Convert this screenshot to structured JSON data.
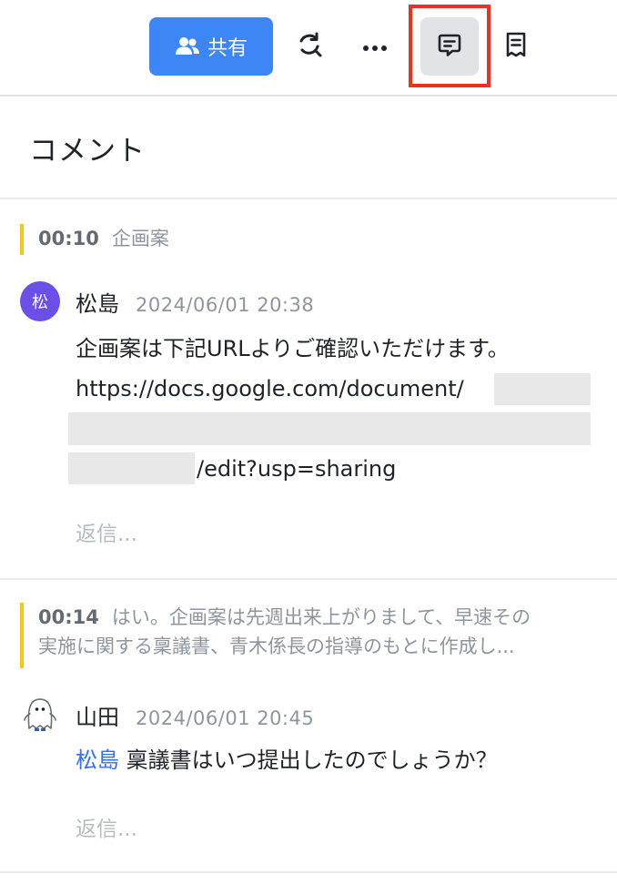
{
  "toolbar": {
    "share_label": "共有",
    "icons": {
      "share": "people-icon",
      "refresh": "refresh-search-icon",
      "more": "more-dots-icon",
      "comment": "comment-icon",
      "doc": "document-icon"
    },
    "accent_color": "#3c86f5",
    "highlight_color": "#e8341f"
  },
  "panel": {
    "title": "コメント"
  },
  "threads": [
    {
      "quote_time": "00:10",
      "quote_text": "企画案",
      "comment": {
        "avatar_text": "松",
        "author": "松島",
        "timestamp": "2024/06/01 20:38",
        "line1": "企画案は下記URLよりご確認いただけます。",
        "url_start": "https://docs.google.com/document/",
        "url_end": "/edit?usp=sharing"
      },
      "reply_placeholder": "返信..."
    },
    {
      "quote_time": "00:14",
      "quote_text_line1": "はい。企画案は先週出来上がりまして、早速その",
      "quote_text_line2": "実施に関する稟議書、青木係長の指導のもとに作成し...",
      "comment": {
        "author": "山田",
        "timestamp": "2024/06/01 20:45",
        "mention": "松島",
        "text": " 稟議書はいつ提出したのでしょうか？"
      },
      "reply_placeholder": "返信..."
    }
  ]
}
